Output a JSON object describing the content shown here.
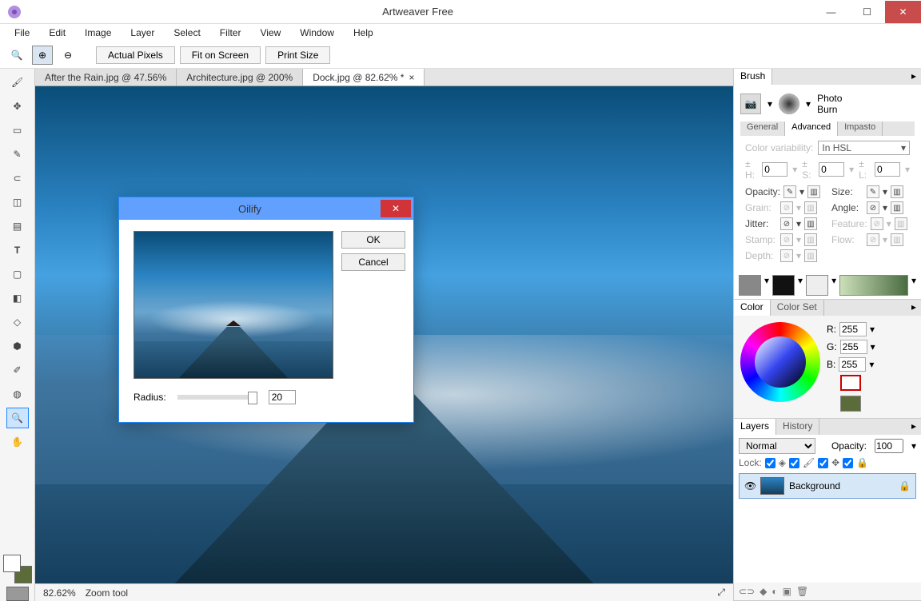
{
  "titlebar": {
    "title": "Artweaver Free"
  },
  "menu": [
    "File",
    "Edit",
    "Image",
    "Layer",
    "Select",
    "Filter",
    "View",
    "Window",
    "Help"
  ],
  "toolbar": {
    "actualPixels": "Actual Pixels",
    "fitOnScreen": "Fit on Screen",
    "printSize": "Print Size"
  },
  "docTabs": [
    {
      "label": "After the Rain.jpg @ 47.56%",
      "active": false
    },
    {
      "label": "Architecture.jpg @ 200%",
      "active": false
    },
    {
      "label": "Dock.jpg @ 82.62% *",
      "active": true
    }
  ],
  "statusbar": {
    "zoom": "82.62%",
    "tool": "Zoom tool"
  },
  "dialog": {
    "title": "Oilify",
    "ok": "OK",
    "cancel": "Cancel",
    "radiusLabel": "Radius:",
    "radiusValue": "20"
  },
  "brushPanel": {
    "tab": "Brush",
    "line1": "Photo",
    "line2": "Burn",
    "subtabs": [
      "General",
      "Advanced",
      "Impasto"
    ],
    "advanced": {
      "colorVarLabel": "Color variability:",
      "colorVarValue": "In HSL",
      "h": "± H:",
      "hv": "0",
      "s": "± S:",
      "sv": "0",
      "l": "± L:",
      "lv": "0",
      "opacity": "Opacity:",
      "size": "Size:",
      "grain": "Grain:",
      "angle": "Angle:",
      "jitter": "Jitter:",
      "feature": "Feature:",
      "stamp": "Stamp:",
      "flow": "Flow:",
      "depth": "Depth:"
    }
  },
  "colorPanel": {
    "tabs": [
      "Color",
      "Color Set"
    ],
    "r": "R:",
    "g": "G:",
    "b": "B:",
    "rv": "255",
    "gv": "255",
    "bv": "255"
  },
  "layersPanel": {
    "tabs": [
      "Layers",
      "History"
    ],
    "mode": "Normal",
    "opacityLabel": "Opacity:",
    "opacityValue": "100",
    "lockLabel": "Lock:",
    "layerName": "Background"
  }
}
